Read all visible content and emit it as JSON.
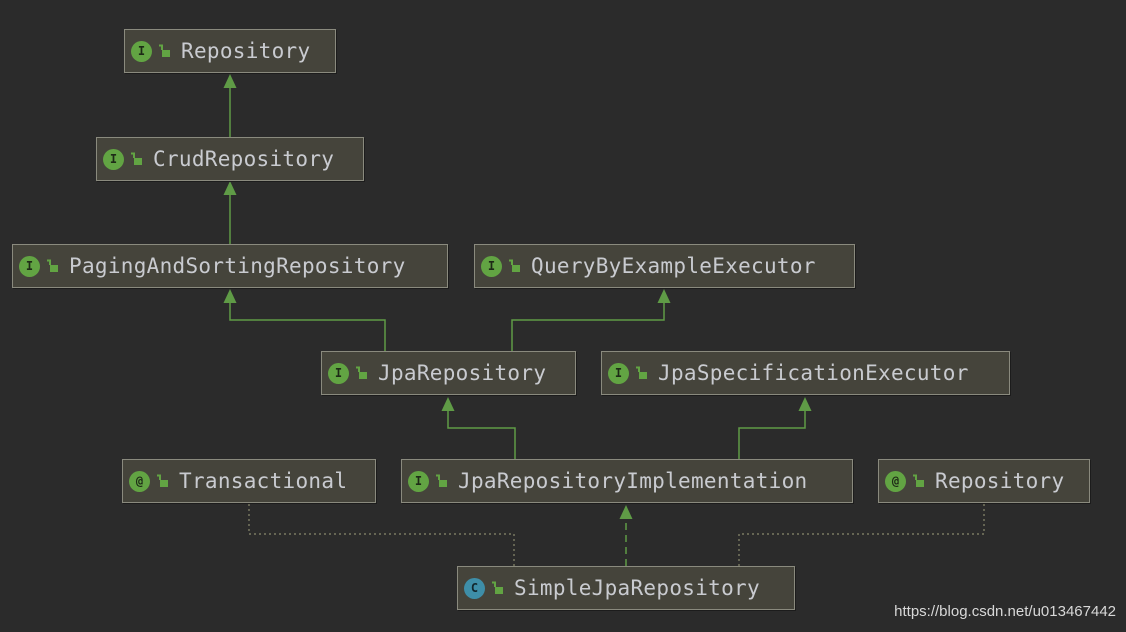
{
  "nodes": {
    "repository": {
      "label": "Repository",
      "kind": "interface",
      "badge": "I"
    },
    "crud_repository": {
      "label": "CrudRepository",
      "kind": "interface",
      "badge": "I"
    },
    "paging_and_sorting_repository": {
      "label": "PagingAndSortingRepository",
      "kind": "interface",
      "badge": "I"
    },
    "query_by_example_executor": {
      "label": "QueryByExampleExecutor",
      "kind": "interface",
      "badge": "I"
    },
    "jpa_repository": {
      "label": "JpaRepository",
      "kind": "interface",
      "badge": "I"
    },
    "jpa_specification_executor": {
      "label": "JpaSpecificationExecutor",
      "kind": "interface",
      "badge": "I"
    },
    "transactional": {
      "label": "Transactional",
      "kind": "annotation",
      "badge": "@"
    },
    "jpa_repository_implementation": {
      "label": "JpaRepositoryImplementation",
      "kind": "interface",
      "badge": "I"
    },
    "repository_annotation": {
      "label": "Repository",
      "kind": "annotation",
      "badge": "@"
    },
    "simple_jpa_repository": {
      "label": "SimpleJpaRepository",
      "kind": "class",
      "badge": "C"
    }
  },
  "edges": [
    {
      "from": "crud_repository",
      "to": "repository",
      "type": "extends"
    },
    {
      "from": "paging_and_sorting_repository",
      "to": "crud_repository",
      "type": "extends"
    },
    {
      "from": "jpa_repository",
      "to": "paging_and_sorting_repository",
      "type": "extends"
    },
    {
      "from": "jpa_repository",
      "to": "query_by_example_executor",
      "type": "extends"
    },
    {
      "from": "jpa_repository_implementation",
      "to": "jpa_repository",
      "type": "extends"
    },
    {
      "from": "jpa_repository_implementation",
      "to": "jpa_specification_executor",
      "type": "extends"
    },
    {
      "from": "simple_jpa_repository",
      "to": "jpa_repository_implementation",
      "type": "implements"
    },
    {
      "from": "simple_jpa_repository",
      "to": "transactional",
      "type": "annotated"
    },
    {
      "from": "simple_jpa_repository",
      "to": "repository_annotation",
      "type": "annotated"
    }
  ],
  "colors": {
    "background": "#2b2b2b",
    "node_fill": "#45443b",
    "node_border": "#8a8a7e",
    "edge": "#5f9b46",
    "annotation_edge": "#8a8a6e",
    "interface_badge": "#62a443",
    "class_badge": "#3e8ea8",
    "text": "#c9cbd0"
  },
  "icons": {
    "visibility": "open-lock-icon"
  },
  "watermark": "https://blog.csdn.net/u013467442"
}
